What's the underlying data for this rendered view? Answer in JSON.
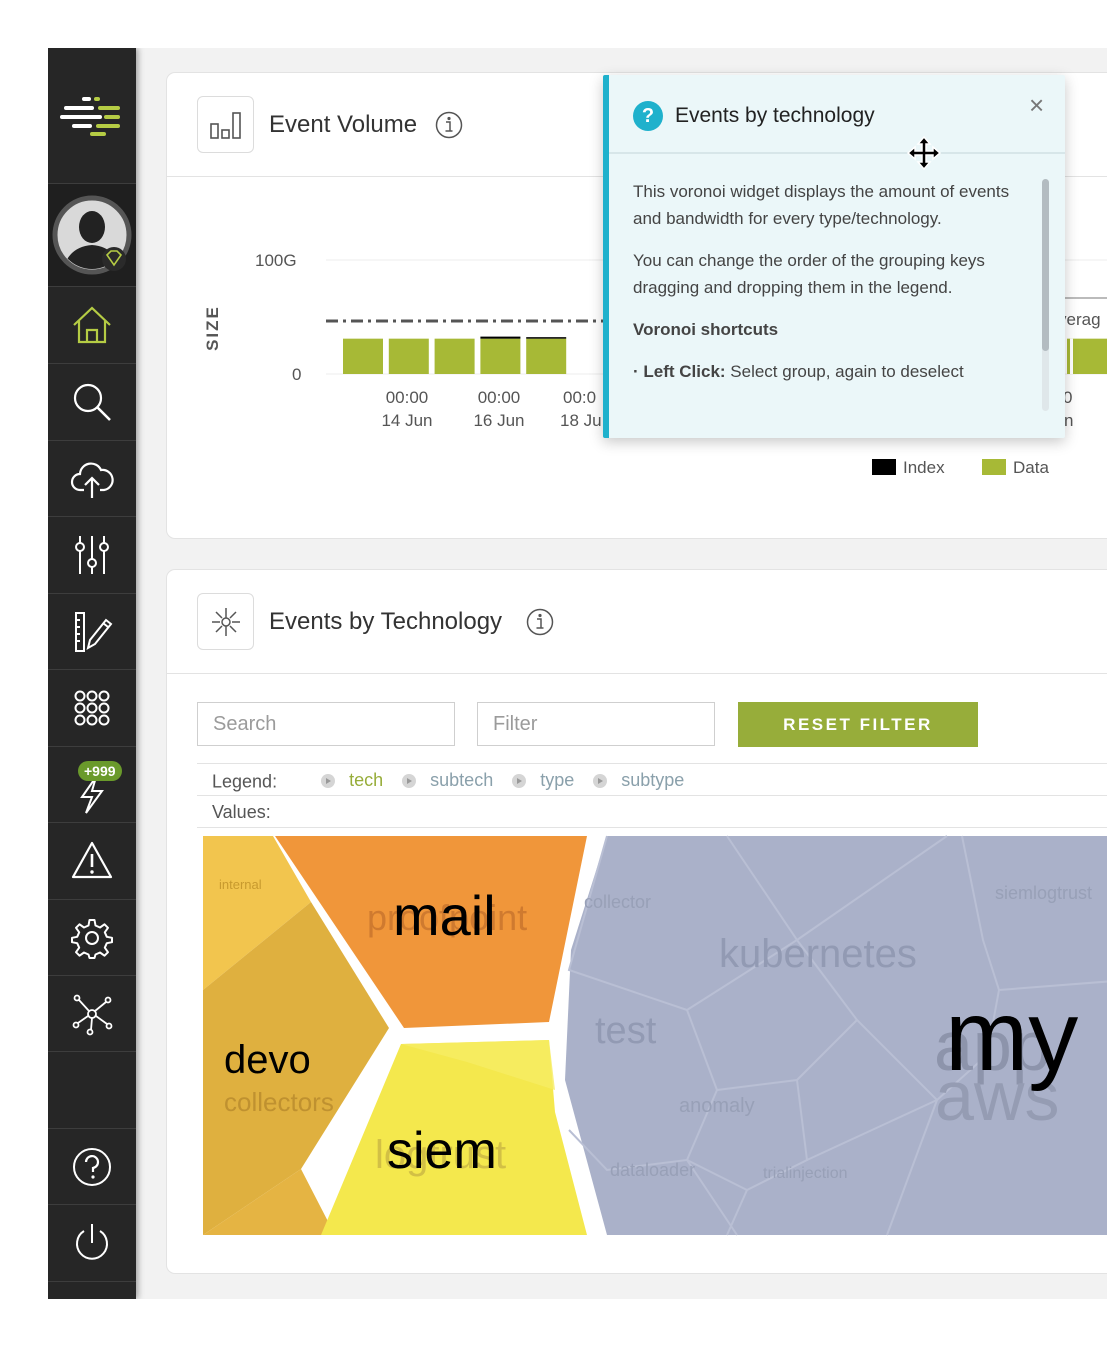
{
  "sidebar": {
    "items": [
      {
        "name": "home",
        "icon": "home-icon"
      },
      {
        "name": "search",
        "icon": "search-icon"
      },
      {
        "name": "upload",
        "icon": "cloud-upload-icon"
      },
      {
        "name": "data-settings",
        "icon": "sliders-icon"
      },
      {
        "name": "editor",
        "icon": "ruler-pencil-icon"
      },
      {
        "name": "apps",
        "icon": "apps-grid-icon"
      },
      {
        "name": "alerts",
        "icon": "lightning-icon",
        "badge": "+999"
      },
      {
        "name": "warnings",
        "icon": "warning-icon"
      },
      {
        "name": "settings",
        "icon": "gear-icon"
      },
      {
        "name": "network",
        "icon": "network-icon"
      },
      {
        "name": "help",
        "icon": "help-icon"
      },
      {
        "name": "logout",
        "icon": "power-icon"
      }
    ],
    "accent": "#b5cc44"
  },
  "event_volume": {
    "title": "Event Volume",
    "y_axis_label": "SIZE",
    "x_ticks": [
      {
        "time": "00:00",
        "date": "14 Jun"
      },
      {
        "time": "00:00",
        "date": "16 Jun"
      },
      {
        "time": "00:0",
        "date": "18 Ju"
      }
    ],
    "right_tick": {
      "time": "0",
      "date": "n"
    },
    "average_label": "verag",
    "legend": [
      {
        "label": "Index",
        "color": "#000000"
      },
      {
        "label": "Data",
        "color": "#a7b936"
      }
    ]
  },
  "chart_data": {
    "type": "bar",
    "title": "Event Volume",
    "ylabel": "SIZE",
    "y_ticks": [
      "100G",
      "0"
    ],
    "series": [
      {
        "name": "Index",
        "values": [
          0,
          0,
          0,
          0.6,
          0.4,
          0.6,
          0.4,
          0.4,
          0.4,
          0.4
        ]
      },
      {
        "name": "Data",
        "values": [
          31,
          31,
          31,
          31,
          31,
          31,
          31,
          31,
          31,
          31
        ]
      }
    ],
    "average_line": 46,
    "ylim": [
      0,
      100
    ]
  },
  "events_by_tech": {
    "title": "Events by Technology",
    "search_placeholder": "Search",
    "filter_placeholder": "Filter",
    "reset_label": "RESET FILTER",
    "legend_label": "Legend:",
    "legend_keys": [
      {
        "label": "tech",
        "color": "#97ad3a"
      },
      {
        "label": "subtech",
        "color": "#8aa0ab"
      },
      {
        "label": "type",
        "color": "#8aa0ab"
      },
      {
        "label": "subtype",
        "color": "#8aa0ab"
      }
    ],
    "values_label": "Values:",
    "voronoi": {
      "mail": "mail",
      "mail_sub": "proofpoint",
      "devo": "devo",
      "devo_sub": "collectors",
      "internal": "internal",
      "siem": "siem",
      "siem_sub": "logtrust",
      "collector": "collector",
      "siemlogtrust": "siemlogtrust",
      "kubernetes": "kubernetes",
      "test": "test",
      "anomaly": "anomaly",
      "dataloader": "dataloader",
      "trialinjection": "trialinjection",
      "my": "my",
      "app": "app",
      "aws": "aws"
    },
    "colors": {
      "mail": "#f0963a",
      "devo": "#e3b040",
      "internal": "#f2c54e",
      "siem": "#f4e84d",
      "my": "#aab1c9"
    }
  },
  "tooltip": {
    "title": "Events by technology",
    "close": "×",
    "paragraphs": [
      "This voronoi widget displays the amount of events and bandwidth for every type/technology.",
      "You can change the order of the grouping keys dragging and dropping them in the legend."
    ],
    "shortcuts_title": "Voronoi shortcuts",
    "shortcut_key": "· Left Click:",
    "shortcut_desc": " Select group, again to deselect"
  }
}
